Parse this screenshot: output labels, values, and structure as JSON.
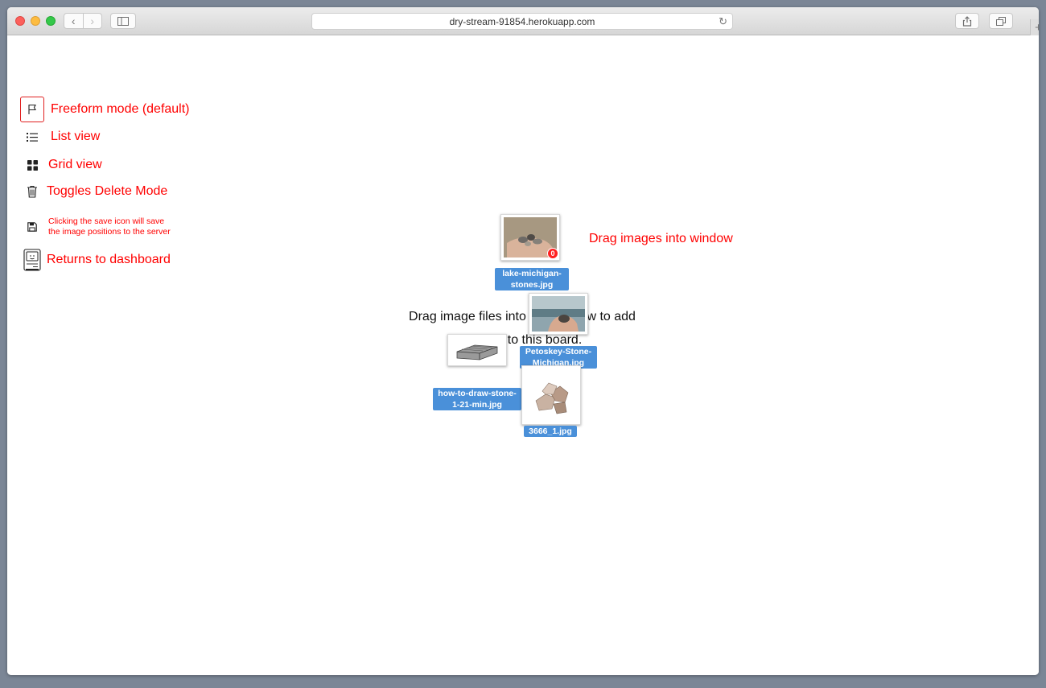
{
  "browser": {
    "url": "dry-stream-91854.herokuapp.com",
    "back_glyph": "‹",
    "forward_glyph": "›",
    "reload_glyph": "↻",
    "newtab_glyph": "+"
  },
  "legend": {
    "freeform_label": "Freeform mode (default)",
    "list_label": "List view",
    "grid_label": "Grid view",
    "delete_label": "Toggles Delete Mode",
    "save_line1": "Clicking the save icon will save",
    "save_line2": "the image positions to the server",
    "dashboard_label": "Returns to dashboard"
  },
  "annotation": {
    "drag_hint": "Drag images into window"
  },
  "board": {
    "empty_line1": "Drag image files into this window to add",
    "empty_line2": "images to this board."
  },
  "images": [
    {
      "name": "lake-michigan-stones.jpg",
      "badge": "0"
    },
    {
      "name": "Petoskey-Stone-Michigan.jpg"
    },
    {
      "name": "how-to-draw-stone-1-21-min.jpg"
    },
    {
      "name": "3666_1.jpg"
    }
  ],
  "colors": {
    "annotation_red": "#ff0000",
    "caption_blue": "#4a90d9"
  },
  "icons": [
    "flag-icon",
    "list-icon",
    "grid-icon",
    "trash-icon",
    "save-icon",
    "computer-icon",
    "share-icon",
    "tabs-icon",
    "sidebar-icon"
  ]
}
